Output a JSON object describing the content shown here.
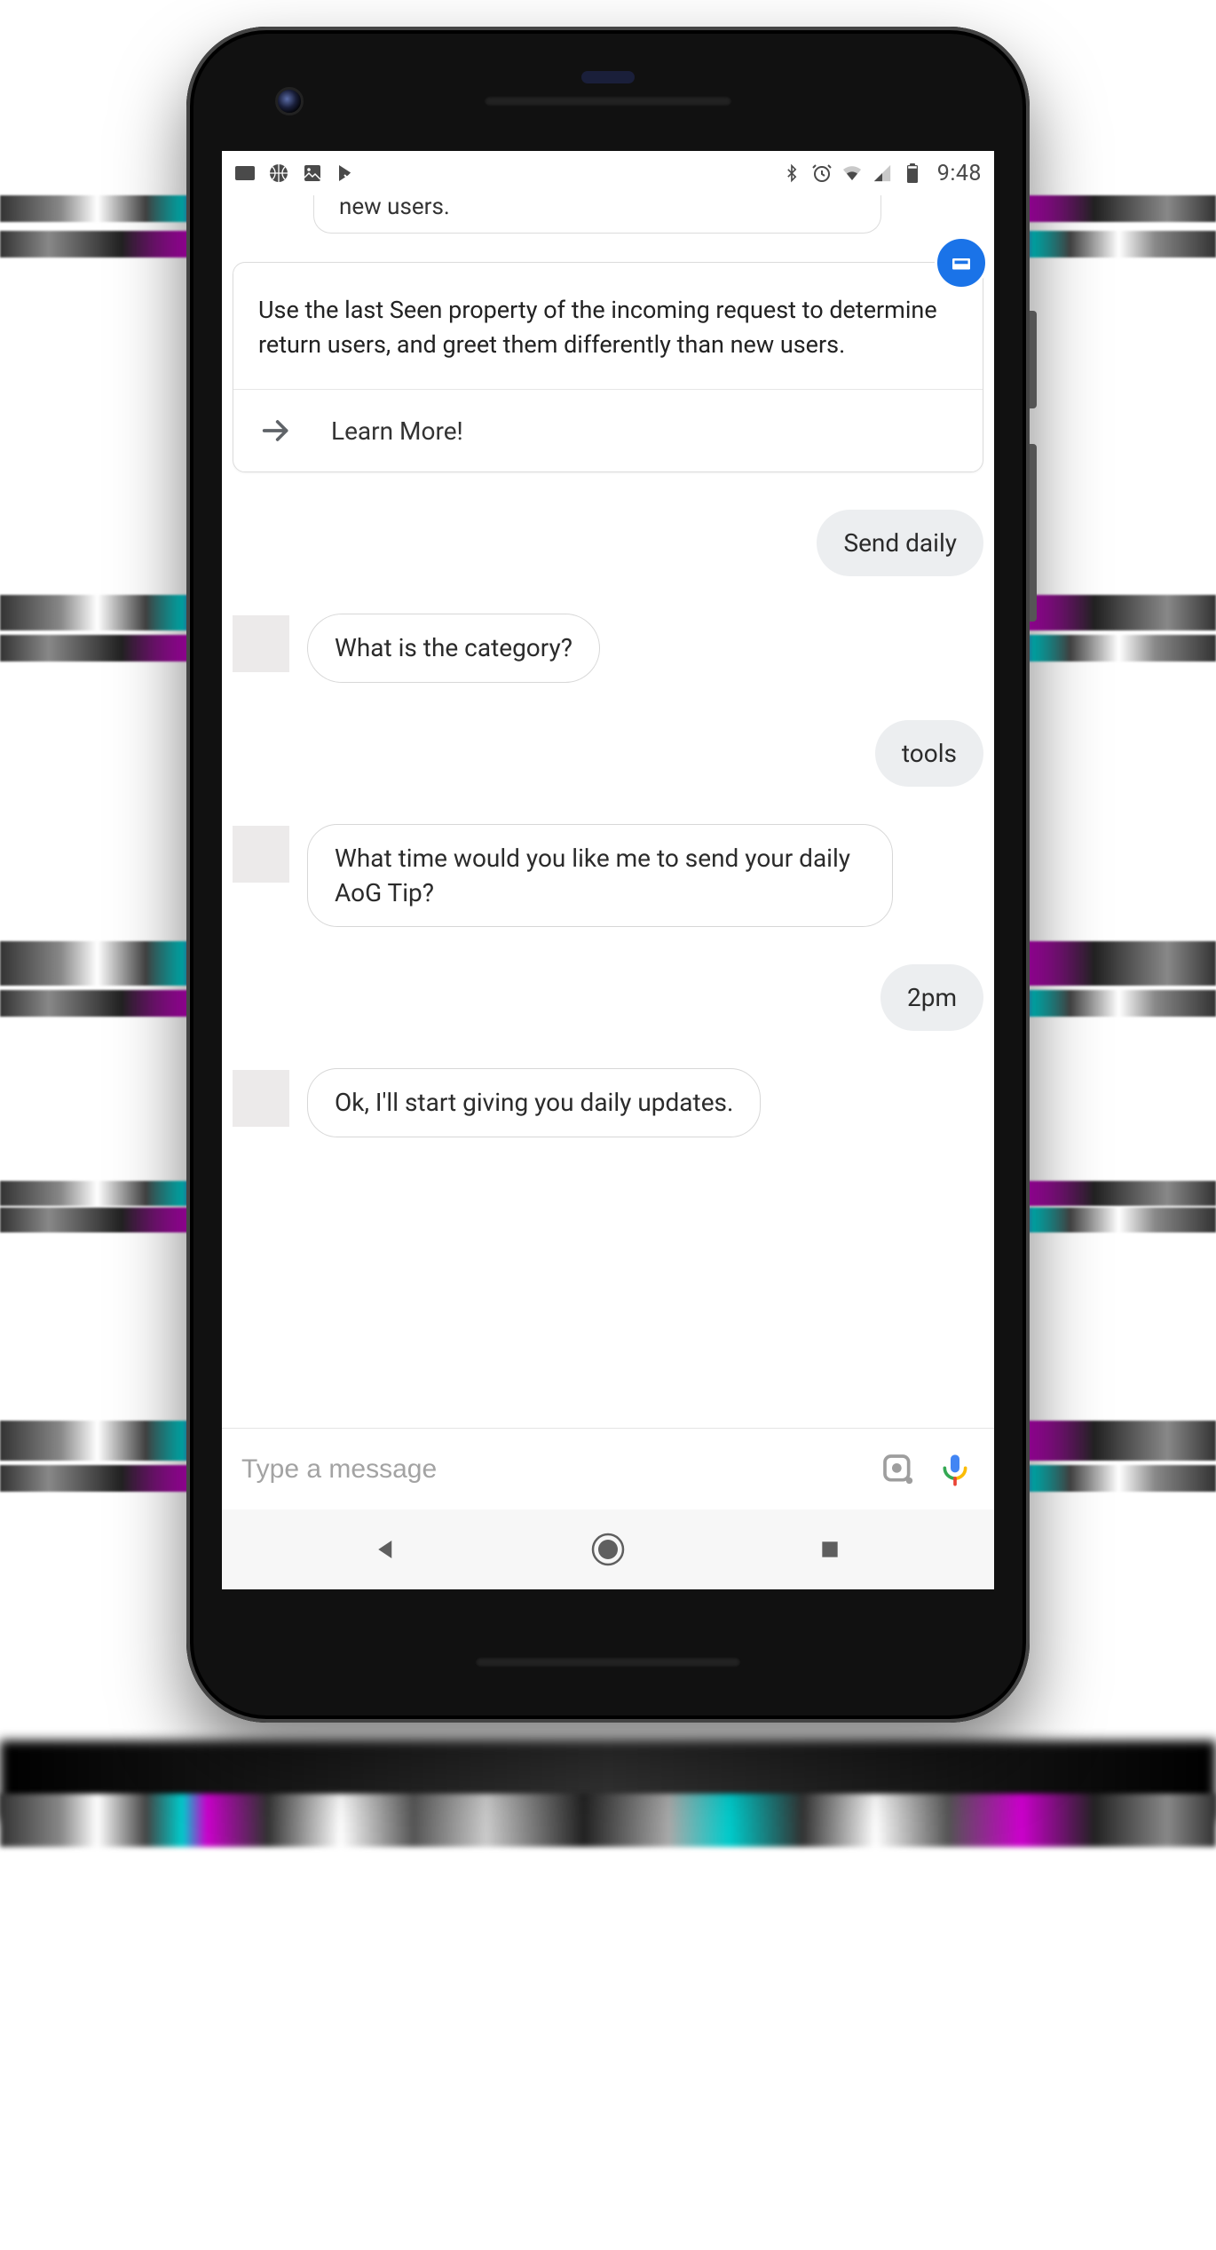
{
  "status_bar": {
    "time": "9:48"
  },
  "card": {
    "peek_text": "new users.",
    "body_text": "Use the last Seen property of the incoming request to determine return users, and greet them differently than new users.",
    "action_label": "Learn More!"
  },
  "messages": {
    "m1_user": "Send daily",
    "m2_bot": "What is the category?",
    "m3_user": "tools",
    "m4_bot": "What time would you like me to send your daily AoG Tip?",
    "m5_user": "2pm",
    "m6_bot": "Ok, I'll start giving you daily updates."
  },
  "input": {
    "placeholder": "Type a message"
  },
  "colors": {
    "accent": "#1a73e8",
    "user_bubble": "#eceef0",
    "bot_border": "#d7d7d7"
  }
}
